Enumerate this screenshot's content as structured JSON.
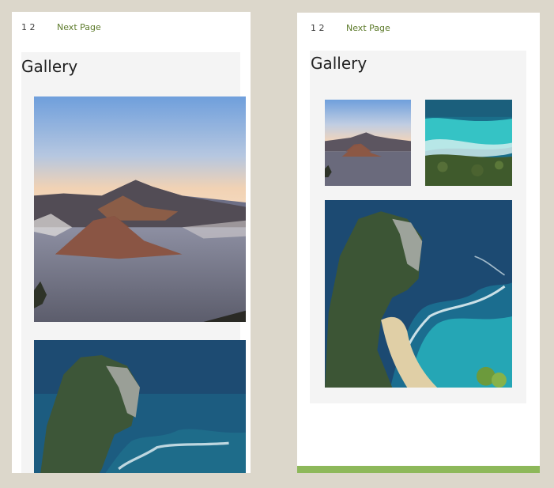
{
  "left_view": {
    "pagination": {
      "pages": "1 2",
      "next": "Next Page"
    },
    "gallery": {
      "title": "Gallery",
      "images": [
        "mountain-volcano-photo",
        "coast-cliff-photo"
      ]
    }
  },
  "right_view": {
    "pagination": {
      "pages": "1 2",
      "next": "Next Page"
    },
    "gallery": {
      "title": "Gallery",
      "images": [
        "mountain-volcano-photo",
        "aerial-sea-photo",
        "coast-cliff-photo"
      ]
    }
  },
  "colors": {
    "page_bg": "#dcd7cb",
    "accent_bar": "#8db85a",
    "link": "#5c7a2a"
  }
}
